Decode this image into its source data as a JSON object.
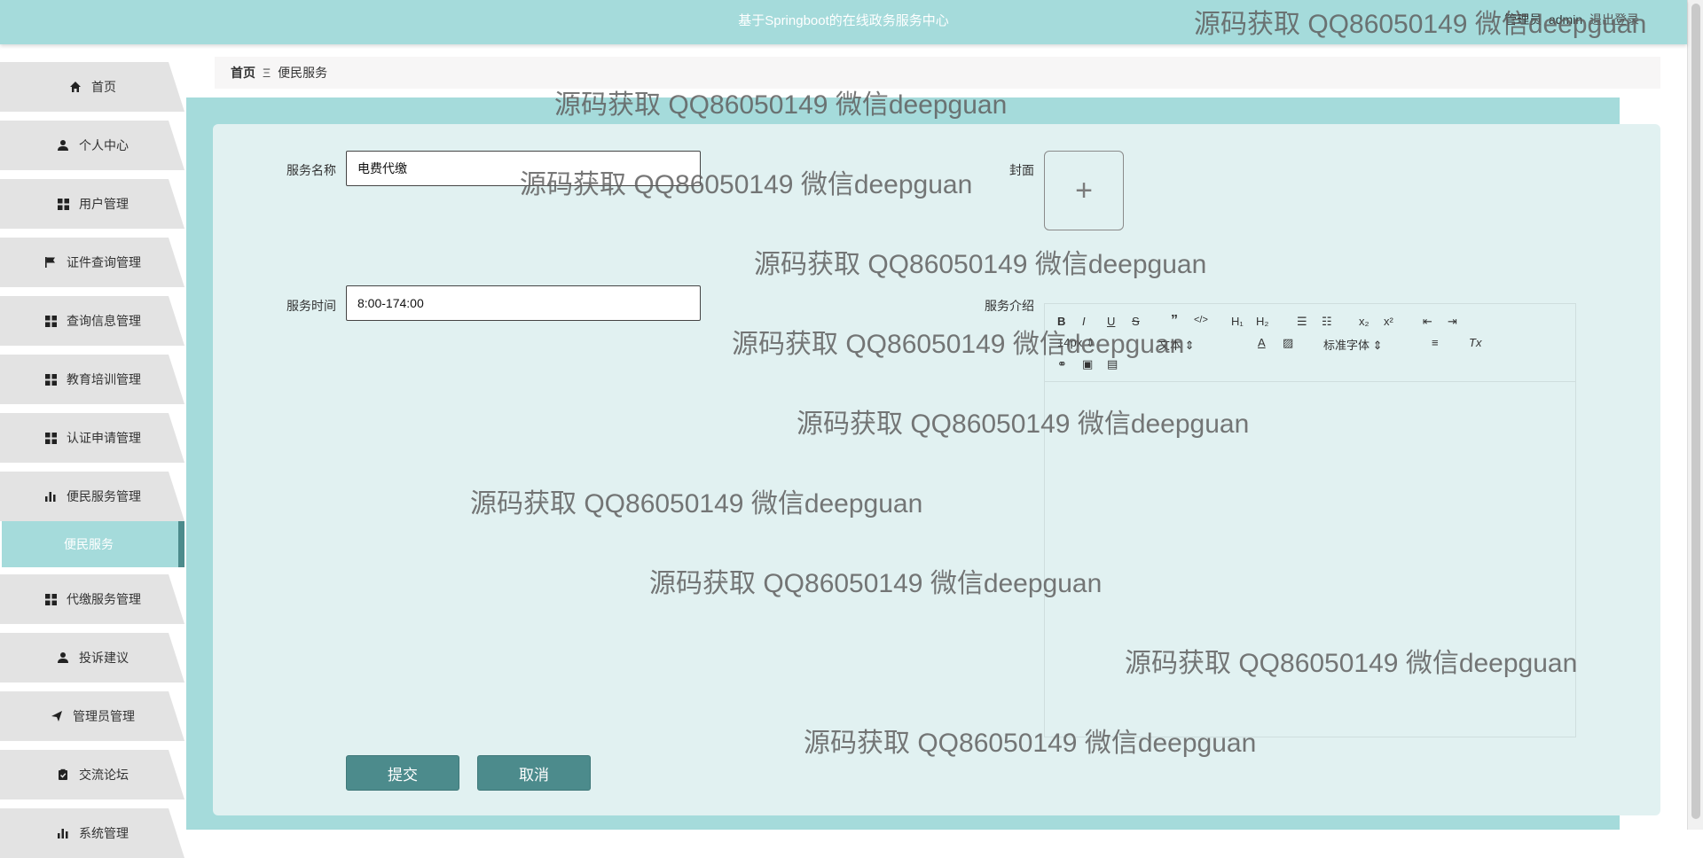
{
  "header": {
    "title": "基于Springboot的在线政务服务中心",
    "user_role": "管理员",
    "user_name": "admin",
    "logout_label": "退出登录"
  },
  "sidebar": {
    "items": [
      {
        "label": "首页",
        "icon": "home-icon"
      },
      {
        "label": "个人中心",
        "icon": "user-icon"
      },
      {
        "label": "用户管理",
        "icon": "grid-icon"
      },
      {
        "label": "证件查询管理",
        "icon": "flag-icon"
      },
      {
        "label": "查询信息管理",
        "icon": "grid-icon"
      },
      {
        "label": "教育培训管理",
        "icon": "grid-icon"
      },
      {
        "label": "认证申请管理",
        "icon": "grid-icon"
      },
      {
        "label": "便民服务管理",
        "icon": "bar-chart-icon"
      },
      {
        "label": "代缴服务管理",
        "icon": "grid-icon"
      },
      {
        "label": "投诉建议",
        "icon": "user-icon"
      },
      {
        "label": "管理员管理",
        "icon": "send-icon"
      },
      {
        "label": "交流论坛",
        "icon": "clipboard-check-icon"
      },
      {
        "label": "系统管理",
        "icon": "bar-chart-icon"
      }
    ],
    "active_sub": "便民服务"
  },
  "breadcrumb": {
    "home": "首页",
    "separator": "Ξ",
    "current": "便民服务"
  },
  "form": {
    "name_label": "服务名称",
    "name_value": "电费代缴",
    "time_label": "服务时间",
    "time_value": "8:00-174:00",
    "cover_label": "封面",
    "intro_label": "服务介绍",
    "submit_label": "提交",
    "cancel_label": "取消"
  },
  "editor": {
    "font_size_select": "14px",
    "header_select": "文本",
    "font_family_select": "标准字体"
  },
  "watermark": "源码获取 QQ86050149 微信deepguan",
  "colors": {
    "header": "#a5dbdb",
    "panel": "#e1f1f1",
    "button": "#4c8b8c",
    "sidebar_item": "#e3e3e3"
  }
}
